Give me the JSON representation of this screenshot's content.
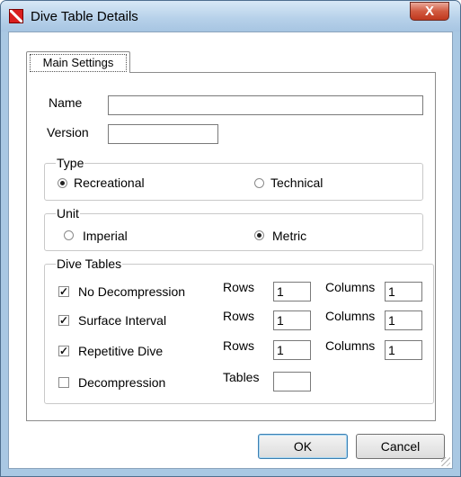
{
  "window": {
    "title": "Dive Table Details",
    "close_label": "X"
  },
  "tabs": [
    {
      "label": "Main Settings"
    }
  ],
  "fields": {
    "name_label": "Name",
    "name_value": "",
    "version_label": "Version",
    "version_value": ""
  },
  "type_group": {
    "legend": "Type",
    "options": [
      "Recreational",
      "Technical"
    ],
    "selected": "Recreational"
  },
  "unit_group": {
    "legend": "Unit",
    "options": [
      "Imperial",
      "Metric"
    ],
    "selected": "Metric"
  },
  "dive_tables": {
    "legend": "Dive Tables",
    "rows": [
      {
        "label": "No Decompression",
        "checked": true,
        "rows_label": "Rows",
        "rows_value": "1",
        "columns_label": "Columns",
        "columns_value": "1"
      },
      {
        "label": "Surface Interval",
        "checked": true,
        "rows_label": "Rows",
        "rows_value": "1",
        "columns_label": "Columns",
        "columns_value": "1"
      },
      {
        "label": "Repetitive Dive",
        "checked": true,
        "rows_label": "Rows",
        "rows_value": "1",
        "columns_label": "Columns",
        "columns_value": "1"
      },
      {
        "label": "Decompression",
        "checked": false,
        "tables_label": "Tables",
        "tables_value": ""
      }
    ]
  },
  "buttons": {
    "ok": "OK",
    "cancel": "Cancel"
  },
  "colors": {
    "title_bar": "#b5d0e9",
    "close_button": "#c0381e",
    "app_icon": "#d91e1e"
  }
}
